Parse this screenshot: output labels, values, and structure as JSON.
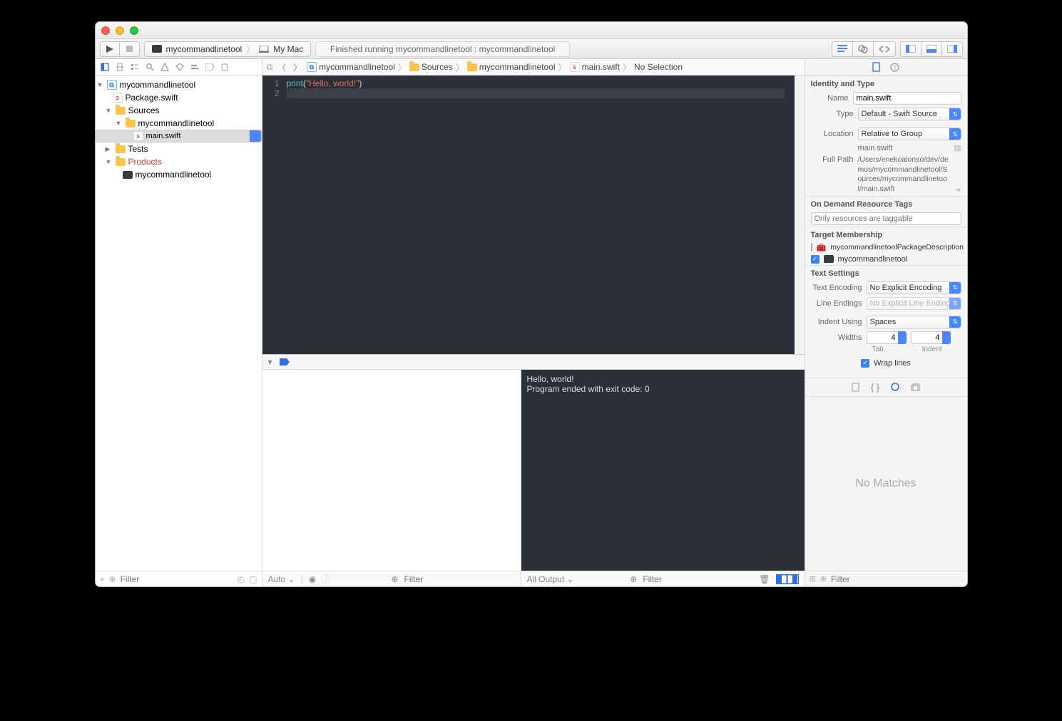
{
  "toolbar": {
    "scheme_target": "mycommandlinetool",
    "scheme_device": "My Mac",
    "status": "Finished running mycommandlinetool : mycommandlinetool"
  },
  "navigator": {
    "filter_placeholder": "Filter",
    "tree": {
      "project": "mycommandlinetool",
      "package": "Package.swift",
      "sources": "Sources",
      "sources_pkg": "mycommandlinetool",
      "main": "main.swift",
      "tests": "Tests",
      "products": "Products",
      "product_bin": "mycommandlinetool"
    }
  },
  "jumpbar": {
    "proj": "mycommandlinetool",
    "sources": "Sources",
    "pkg": "mycommandlinetool",
    "file": "main.swift",
    "sel": "No Selection"
  },
  "editor": {
    "line1_fn": "print",
    "line1_open": "(",
    "line1_str": "\"Hello, world!\"",
    "line1_close": ")"
  },
  "console": {
    "line1": "Hello, world!",
    "line2": "Program ended with exit code: 0"
  },
  "debug": {
    "auto": "Auto",
    "vars_filter": "Filter",
    "all_output": "All Output",
    "console_filter": "Filter"
  },
  "inspector": {
    "identity_hdr": "Identity and Type",
    "name_lbl": "Name",
    "name_val": "main.swift",
    "type_lbl": "Type",
    "type_val": "Default - Swift Source",
    "location_lbl": "Location",
    "location_val": "Relative to Group",
    "location_path": "main.swift",
    "fullpath_lbl": "Full Path",
    "fullpath_val": "/Users/enekoalonso/dev/demos/mycommandlinetool/Sources/mycommandlinetool/main.swift",
    "odr_hdr": "On Demand Resource Tags",
    "odr_placeholder": "Only resources are taggable",
    "target_hdr": "Target Membership",
    "target1": "mycommandlinetoolPackageDescription",
    "target2": "mycommandlinetool",
    "text_hdr": "Text Settings",
    "enc_lbl": "Text Encoding",
    "enc_val": "No Explicit Encoding",
    "le_lbl": "Line Endings",
    "le_val": "No Explicit Line Endings",
    "indent_lbl": "Indent Using",
    "indent_val": "Spaces",
    "widths_lbl": "Widths",
    "tab_val": "4",
    "indent_val_num": "4",
    "tab_sub": "Tab",
    "indent_sub": "Indent",
    "wrap_lbl": "Wrap lines",
    "nomatches": "No Matches",
    "lib_filter": "Filter"
  }
}
